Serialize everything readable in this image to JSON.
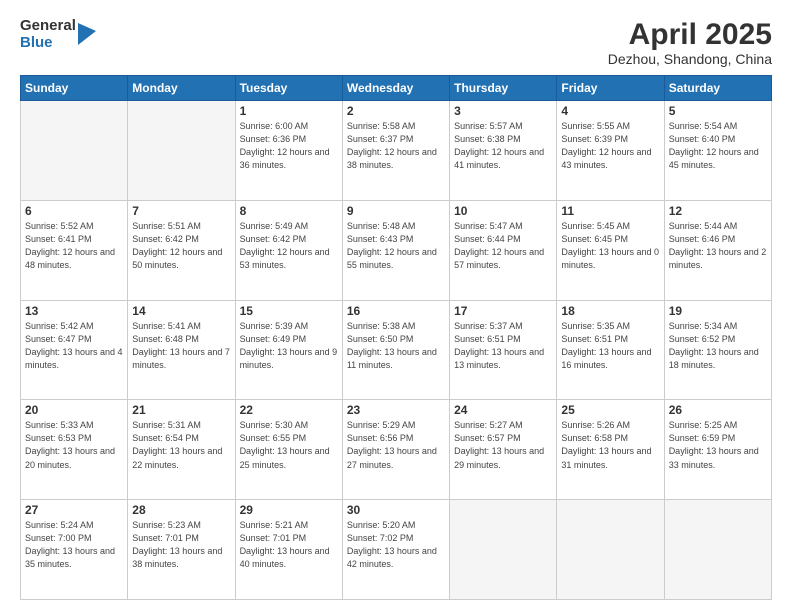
{
  "header": {
    "logo_general": "General",
    "logo_blue": "Blue",
    "main_title": "April 2025",
    "subtitle": "Dezhou, Shandong, China"
  },
  "weekdays": [
    "Sunday",
    "Monday",
    "Tuesday",
    "Wednesday",
    "Thursday",
    "Friday",
    "Saturday"
  ],
  "weeks": [
    [
      {
        "day": "",
        "sunrise": "",
        "sunset": "",
        "daylight": ""
      },
      {
        "day": "",
        "sunrise": "",
        "sunset": "",
        "daylight": ""
      },
      {
        "day": "1",
        "sunrise": "Sunrise: 6:00 AM",
        "sunset": "Sunset: 6:36 PM",
        "daylight": "Daylight: 12 hours and 36 minutes."
      },
      {
        "day": "2",
        "sunrise": "Sunrise: 5:58 AM",
        "sunset": "Sunset: 6:37 PM",
        "daylight": "Daylight: 12 hours and 38 minutes."
      },
      {
        "day": "3",
        "sunrise": "Sunrise: 5:57 AM",
        "sunset": "Sunset: 6:38 PM",
        "daylight": "Daylight: 12 hours and 41 minutes."
      },
      {
        "day": "4",
        "sunrise": "Sunrise: 5:55 AM",
        "sunset": "Sunset: 6:39 PM",
        "daylight": "Daylight: 12 hours and 43 minutes."
      },
      {
        "day": "5",
        "sunrise": "Sunrise: 5:54 AM",
        "sunset": "Sunset: 6:40 PM",
        "daylight": "Daylight: 12 hours and 45 minutes."
      }
    ],
    [
      {
        "day": "6",
        "sunrise": "Sunrise: 5:52 AM",
        "sunset": "Sunset: 6:41 PM",
        "daylight": "Daylight: 12 hours and 48 minutes."
      },
      {
        "day": "7",
        "sunrise": "Sunrise: 5:51 AM",
        "sunset": "Sunset: 6:42 PM",
        "daylight": "Daylight: 12 hours and 50 minutes."
      },
      {
        "day": "8",
        "sunrise": "Sunrise: 5:49 AM",
        "sunset": "Sunset: 6:42 PM",
        "daylight": "Daylight: 12 hours and 53 minutes."
      },
      {
        "day": "9",
        "sunrise": "Sunrise: 5:48 AM",
        "sunset": "Sunset: 6:43 PM",
        "daylight": "Daylight: 12 hours and 55 minutes."
      },
      {
        "day": "10",
        "sunrise": "Sunrise: 5:47 AM",
        "sunset": "Sunset: 6:44 PM",
        "daylight": "Daylight: 12 hours and 57 minutes."
      },
      {
        "day": "11",
        "sunrise": "Sunrise: 5:45 AM",
        "sunset": "Sunset: 6:45 PM",
        "daylight": "Daylight: 13 hours and 0 minutes."
      },
      {
        "day": "12",
        "sunrise": "Sunrise: 5:44 AM",
        "sunset": "Sunset: 6:46 PM",
        "daylight": "Daylight: 13 hours and 2 minutes."
      }
    ],
    [
      {
        "day": "13",
        "sunrise": "Sunrise: 5:42 AM",
        "sunset": "Sunset: 6:47 PM",
        "daylight": "Daylight: 13 hours and 4 minutes."
      },
      {
        "day": "14",
        "sunrise": "Sunrise: 5:41 AM",
        "sunset": "Sunset: 6:48 PM",
        "daylight": "Daylight: 13 hours and 7 minutes."
      },
      {
        "day": "15",
        "sunrise": "Sunrise: 5:39 AM",
        "sunset": "Sunset: 6:49 PM",
        "daylight": "Daylight: 13 hours and 9 minutes."
      },
      {
        "day": "16",
        "sunrise": "Sunrise: 5:38 AM",
        "sunset": "Sunset: 6:50 PM",
        "daylight": "Daylight: 13 hours and 11 minutes."
      },
      {
        "day": "17",
        "sunrise": "Sunrise: 5:37 AM",
        "sunset": "Sunset: 6:51 PM",
        "daylight": "Daylight: 13 hours and 13 minutes."
      },
      {
        "day": "18",
        "sunrise": "Sunrise: 5:35 AM",
        "sunset": "Sunset: 6:51 PM",
        "daylight": "Daylight: 13 hours and 16 minutes."
      },
      {
        "day": "19",
        "sunrise": "Sunrise: 5:34 AM",
        "sunset": "Sunset: 6:52 PM",
        "daylight": "Daylight: 13 hours and 18 minutes."
      }
    ],
    [
      {
        "day": "20",
        "sunrise": "Sunrise: 5:33 AM",
        "sunset": "Sunset: 6:53 PM",
        "daylight": "Daylight: 13 hours and 20 minutes."
      },
      {
        "day": "21",
        "sunrise": "Sunrise: 5:31 AM",
        "sunset": "Sunset: 6:54 PM",
        "daylight": "Daylight: 13 hours and 22 minutes."
      },
      {
        "day": "22",
        "sunrise": "Sunrise: 5:30 AM",
        "sunset": "Sunset: 6:55 PM",
        "daylight": "Daylight: 13 hours and 25 minutes."
      },
      {
        "day": "23",
        "sunrise": "Sunrise: 5:29 AM",
        "sunset": "Sunset: 6:56 PM",
        "daylight": "Daylight: 13 hours and 27 minutes."
      },
      {
        "day": "24",
        "sunrise": "Sunrise: 5:27 AM",
        "sunset": "Sunset: 6:57 PM",
        "daylight": "Daylight: 13 hours and 29 minutes."
      },
      {
        "day": "25",
        "sunrise": "Sunrise: 5:26 AM",
        "sunset": "Sunset: 6:58 PM",
        "daylight": "Daylight: 13 hours and 31 minutes."
      },
      {
        "day": "26",
        "sunrise": "Sunrise: 5:25 AM",
        "sunset": "Sunset: 6:59 PM",
        "daylight": "Daylight: 13 hours and 33 minutes."
      }
    ],
    [
      {
        "day": "27",
        "sunrise": "Sunrise: 5:24 AM",
        "sunset": "Sunset: 7:00 PM",
        "daylight": "Daylight: 13 hours and 35 minutes."
      },
      {
        "day": "28",
        "sunrise": "Sunrise: 5:23 AM",
        "sunset": "Sunset: 7:01 PM",
        "daylight": "Daylight: 13 hours and 38 minutes."
      },
      {
        "day": "29",
        "sunrise": "Sunrise: 5:21 AM",
        "sunset": "Sunset: 7:01 PM",
        "daylight": "Daylight: 13 hours and 40 minutes."
      },
      {
        "day": "30",
        "sunrise": "Sunrise: 5:20 AM",
        "sunset": "Sunset: 7:02 PM",
        "daylight": "Daylight: 13 hours and 42 minutes."
      },
      {
        "day": "",
        "sunrise": "",
        "sunset": "",
        "daylight": ""
      },
      {
        "day": "",
        "sunrise": "",
        "sunset": "",
        "daylight": ""
      },
      {
        "day": "",
        "sunrise": "",
        "sunset": "",
        "daylight": ""
      }
    ]
  ]
}
